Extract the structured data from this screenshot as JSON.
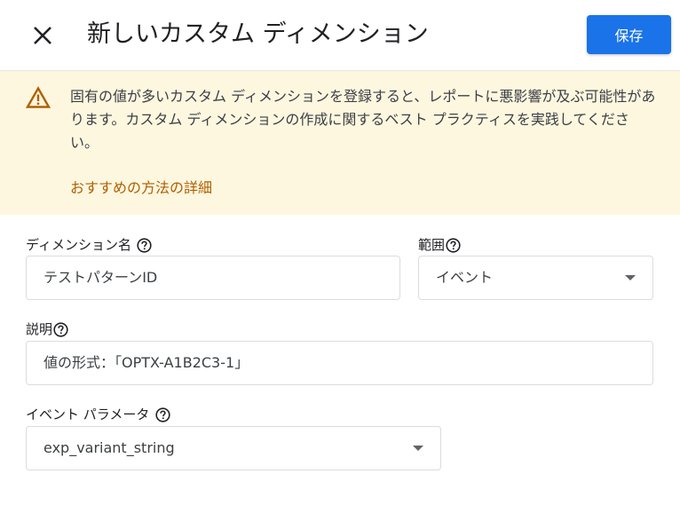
{
  "header": {
    "close_icon": "close-icon",
    "title": "新しいカスタム ディメンション",
    "save_label": "保存"
  },
  "warning": {
    "icon": "warning-triangle-icon",
    "message": "固有の値が多いカスタム ディメンションを登録すると、レポートに悪影響が及ぶ可能性があります。カスタム ディメンションの作成に関するベスト プラクティスを実践してください。",
    "link": "おすすめの方法の詳細"
  },
  "form": {
    "dimension_name": {
      "label": "ディメンション名",
      "value": "テストパターンID"
    },
    "scope": {
      "label": "範囲",
      "value": "イベント"
    },
    "description": {
      "label": "説明",
      "value": "値の形式：「OPTX-A1B2C3-1」"
    },
    "event_parameter": {
      "label": "イベント パラメータ",
      "value": "exp_variant_string"
    }
  },
  "colors": {
    "accent": "#1a73e8",
    "warning_bg": "#fef7e0",
    "warning_icon": "#b06000",
    "link": "#b06000"
  }
}
